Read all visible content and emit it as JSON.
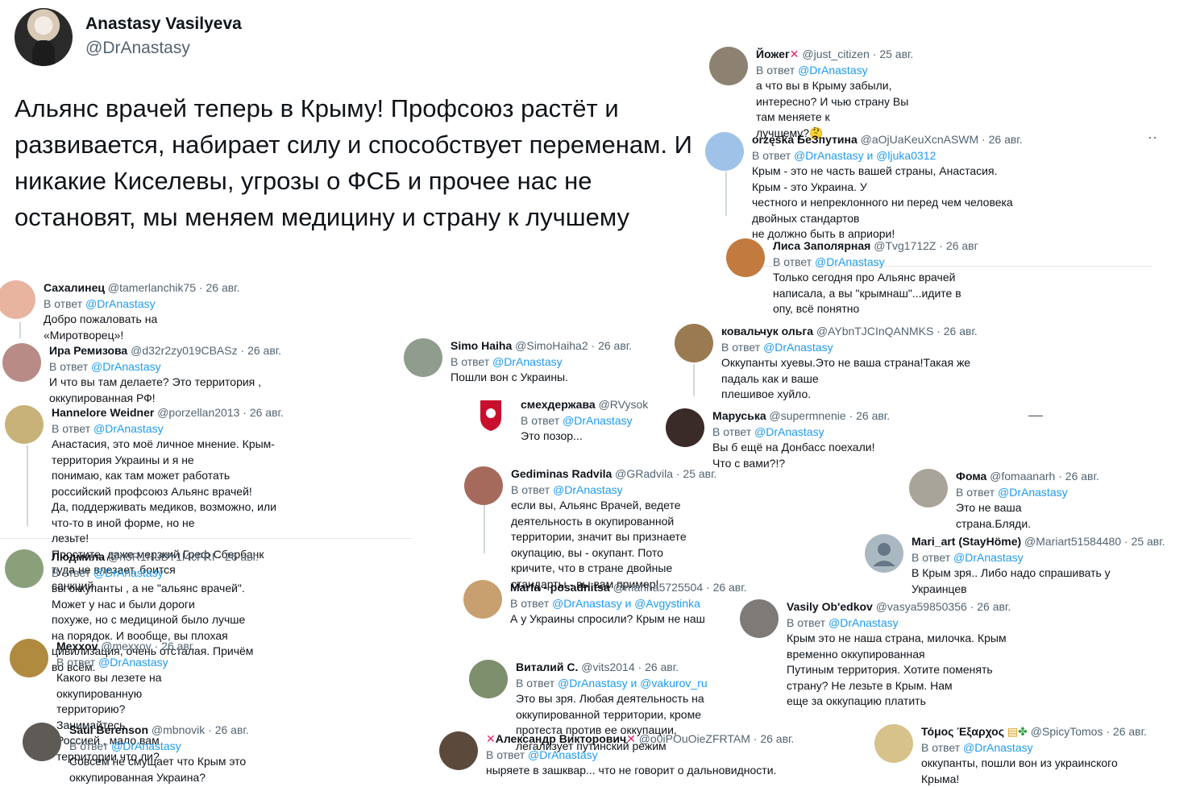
{
  "main": {
    "name": "Anastasy Vasilyeva",
    "handle": "@DrAnastasy",
    "text": "Альянс врачей теперь в Крыму!  Профсоюз растёт и развивается, набирает силу и способствует переменам. И никакие Киселевы, угрозы о ФСБ и прочее нас не остановят, мы меняем медицину и страну к лучшему"
  },
  "reply_prefix": "В ответ",
  "replies": [
    {
      "name": "Сахалинец",
      "handle": "@tamerlanchik75",
      "date": "26 авг.",
      "to": "@DrAnastasy",
      "text": "Добро пожаловать на «Миротворец»!",
      "avatar_color": "#e8b4a0"
    },
    {
      "name": "Ира Ремизова",
      "handle": "@d32r2zy019CBASz",
      "date": "26 авг.",
      "to": "@DrAnastasy",
      "text": "И что вы там делаете? Это территория , оккупированная РФ!",
      "avatar_color": "#b98b86"
    },
    {
      "name": "Hannelore Weidner",
      "handle": "@porzellan2013",
      "date": "26 авг.",
      "to": "@DrAnastasy",
      "text": "Анастасия, это моё личное мнение. Крым-территория Украины и я не\nпонимаю, как там может работать российский профсоюз Альянс врачей!\nДа, поддерживать медиков, возможно, или что-то в иной форме, но не\nлезьте!\nПростите, даже мерзкий Греф Сбербанк туда не влезает, боится\nсанкций...",
      "avatar_color": "#c9b27a"
    },
    {
      "name": "Людмила",
      "handle": "@n5R1HuBY1l4cFRI",
      "date": "26 авг.",
      "to": "@DrAnastasy",
      "text": "вы оккупанты , а не \"альянс врачей\". Может у нас и  были дороги\nпохуже, но с медициной было лучше на порядок. И вообще, вы  плохая\nцивилизация, очень отсталая. Причём во всём.",
      "avatar_color": "#8aa07a"
    },
    {
      "name": "Mexxov",
      "handle": "@mexxov",
      "date": "26 авг.",
      "to": "@DrAnastasy",
      "text": "Какого вы лезете на оккупированную территорию? Занимайтесь\nРоссией , мало вам территории что ли?",
      "avatar_color": "#b08a3e"
    },
    {
      "name": "Saul Berenson",
      "handle": "@mbnovik",
      "date": "26 авг.",
      "to": "@DrAnastasy",
      "text": "Совсем не смущает что Крым это оккупированная Украина?",
      "avatar_color": "#5e5a55"
    },
    {
      "name": "Simo Haiha",
      "handle": "@SimoHaiha2",
      "date": "26 авг.",
      "to": "@DrAnastasy",
      "text": "Пошли вон с Украины.",
      "avatar_color": "#8f9c8e"
    },
    {
      "name": "смехдержава",
      "handle": "@RVysok",
      "date": "",
      "to": "@DrAnastasy",
      "text": "Это позор...",
      "avatar_color": "#d9534f"
    },
    {
      "name": "Gediminas Radvila",
      "handle": "@GRadvila",
      "date": "25 авг.",
      "to": "@DrAnastasy",
      "text": "если вы, Альянс Врачей, ведете деятельность в окупированной\nтерритории, значит вы признаете окупацию, вы - окупант. Пото\nкричите, что в стране двойные стандарты - вы вам пример!",
      "avatar_color": "#a66a5c"
    },
    {
      "name": "Marfa - posadnitsa",
      "handle": "@marina5725504",
      "date": "26 авг.",
      "to": "@DrAnastasy и @Avgystinka",
      "text": "А у Украины спросили? Крым не наш",
      "avatar_color": "#c8a070"
    },
    {
      "name": "Виталий С.",
      "handle": "@vits2014",
      "date": "26 авг.",
      "to": "@DrAnastasy и @vakurov_ru",
      "text": "Это вы зря. Любая деятельность на оккупированной территории, кроме\nпротеста против ее оккупации, легализует путинский режим",
      "avatar_color": "#7e8f6e"
    },
    {
      "name": "Александр Викторович",
      "handle": "@o0iPOuOieZFRTAM",
      "date": "26 авг.",
      "to": "@DrAnastasy",
      "text": "ныряете в зашквар... что не говорит о дальновидности.",
      "avatar_color": "#5b4a3c"
    },
    {
      "name": "Йожег",
      "handle": "@just_citizen",
      "date": "25 авг.",
      "to": "@DrAnastasy",
      "text": "а что вы в Крыму забыли, интересно? И чью страну Вы там меняете к\nлучшему?🤔",
      "avatar_color": "#8d8272"
    },
    {
      "name": "orzęska БеЗпутина",
      "handle": "@aOjUaKeuXcnASWM",
      "date": "26 авг.",
      "to": "@DrAnastasy и @ljuka0312",
      "text": "Крым - это не часть вашей страны, Анастасия. Крым - это Украина. У\nчестного и непреклонного ни перед чем человека двойных стандартов\nне должно быть в априори!",
      "avatar_color": "#9fc3e8"
    },
    {
      "name": "Лиса Заполярная",
      "handle": "@Tvg1712Z",
      "date": "26 авг",
      "to": "@DrAnastasy",
      "text": "Только сегодня про Альянс врачей написала, а вы \"крымнаш\"...идите в\nопу, всё понятно",
      "avatar_color": "#c27a3e"
    },
    {
      "name": "ковальчук ольга",
      "handle": "@AYbnTJCInQANMKS",
      "date": "26 авг.",
      "to": "@DrAnastasy",
      "text": "Оккупанты хуевы.Это не ваша страна!Такая же падаль как и ваше\nплешивое хуйло.",
      "avatar_color": "#9a7a50"
    },
    {
      "name": "Маруська",
      "handle": "@supermnenie",
      "date": "26 авг.",
      "to": "@DrAnastasy",
      "text": "Вы б ещё на Донбасс поехали! Что с вами?!?",
      "avatar_color": "#3a2a28"
    },
    {
      "name": "Фома",
      "handle": "@fomaanarh",
      "date": "26 авг.",
      "to": "@DrAnastasy",
      "text": "Это не ваша страна.Бляди.",
      "avatar_color": "#a9a49a"
    },
    {
      "name": "Mari_art (StayHöme)",
      "handle": "@Mariart51584480",
      "date": "25 авг.",
      "to": "@DrAnastasy",
      "text": "В Крым зря.. Либо надо спрашивать у Украинцев",
      "avatar_color": "#aab8c2"
    },
    {
      "name": "Vasily Ob'edkov",
      "handle": "@vasya59850356",
      "date": "26 авг.",
      "to": "@DrAnastasy",
      "text": "Крым это не наша страна, милочка. Крым временно оккупированная\nПутиным территория. Хотите поменять страну? Не лезьте в Крым. Нам\nеще за оккупацию платить",
      "avatar_color": "#7d7a78"
    },
    {
      "name": "Τόμος Έξαρχος",
      "handle": "@SpicyTomos",
      "date": "26 авг.",
      "to": "@DrAnastasy",
      "text": "оккупанты, пошли вон из украинского Крыма!",
      "avatar_color": "#d6c28a"
    }
  ]
}
